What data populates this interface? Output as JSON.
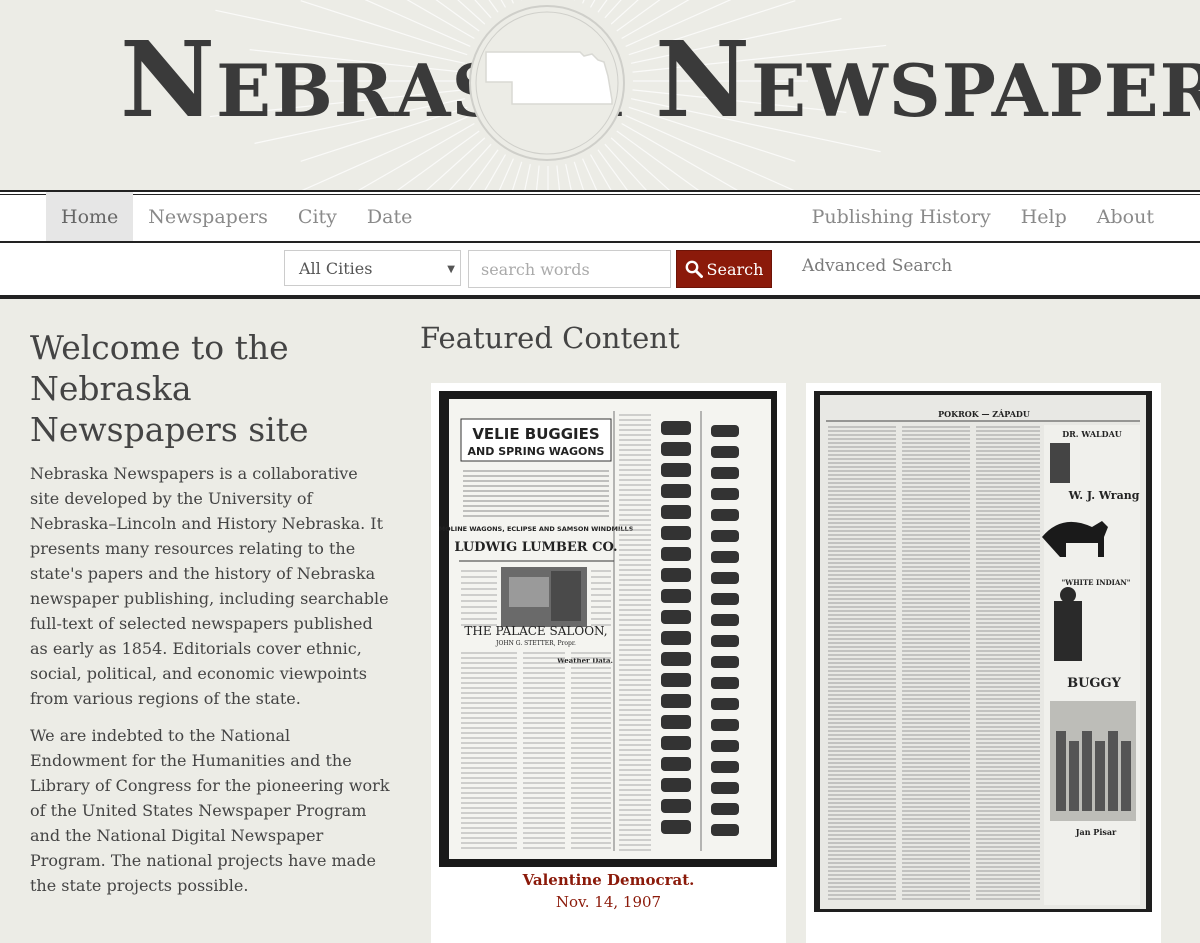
{
  "logo": {
    "left_cap": "N",
    "left_rest": "EBRASKA",
    "right_cap": "N",
    "right_rest": "EWSPAPERS"
  },
  "nav": {
    "left": [
      "Home",
      "Newspapers",
      "City",
      "Date"
    ],
    "right": [
      "Publishing History",
      "Help",
      "About"
    ],
    "active": "Home"
  },
  "search": {
    "city_selected": "All Cities",
    "placeholder": "search words",
    "button_label": "Search",
    "advanced_label": "Advanced Search"
  },
  "welcome": {
    "title": "Welcome to the Nebraska Newspapers site",
    "intro": "Nebraska Newspapers is a collaborative site developed by the University of Nebraska–Lincoln and History Nebraska. It presents many resources relating to the state's papers and the history of Nebraska newspaper publishing, including searchable full-text of selected newspapers published as early as 1854. Editorials cover ethnic, social, political, and economic viewpoints from various regions of the state.",
    "thanks": "We are indebted to the National Endowment for the Humanities and the Library of Congress for the pioneering work of the United States Newspaper Program and the National Digital Newspaper Program. The national projects have made the state projects possible."
  },
  "featured": {
    "title": "Featured Content",
    "items": [
      {
        "title": "Valentine Democrat.",
        "date": "Nov. 14, 1907",
        "ad_headline": "VELIE BUGGIES",
        "ad_sub": "AND SPRING WAGONS",
        "ad_mid": "MOLINE WAGONS, ECLIPSE AND SAMSON WINDMILLS",
        "ad_lumber": "LUDWIG LUMBER CO.",
        "saloon": "THE PALACE SALOON,",
        "saloon_sub": "JOHN G. STETTER, Propr.",
        "weather": "Weather Data."
      },
      {
        "title": "",
        "date": "",
        "header": "POKROK — ZÁPADU",
        "ad1": "DR. WALDAU",
        "ad2": "W. J. Wrang",
        "ad3": "\"WHITE INDIAN\"",
        "ad4": "BUGGY",
        "ad5": "Jan Pisar"
      }
    ]
  },
  "colors": {
    "accent": "#8b1a0a",
    "nav_text": "#8a8a8a",
    "background": "#ecece6"
  },
  "icons": {
    "search": "search-icon",
    "caret": "chevron-down-icon",
    "nebraska_map": "nebraska-map-icon"
  }
}
